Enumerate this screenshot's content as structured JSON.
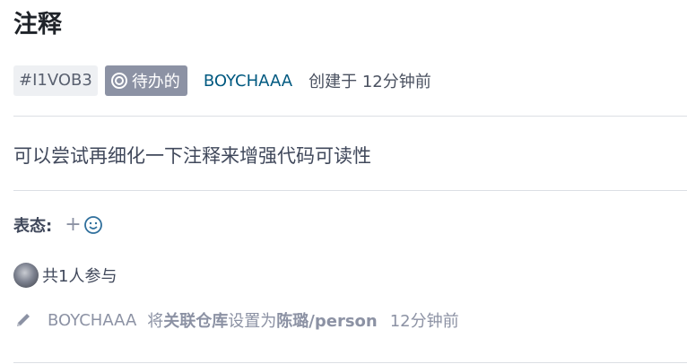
{
  "issue": {
    "title": "注释",
    "id": "#I1VOB3",
    "status": "待办的",
    "status_icon": "target-circle-icon",
    "author": "BOYCHAAA",
    "created": "创建于 12分钟前",
    "body": "可以尝试再细化一下注释来增强代码可读性"
  },
  "reactions": {
    "label": "表态:",
    "add_symbol": "+",
    "emoji_icon": "smiley-icon"
  },
  "participants": {
    "text": "共1人参与"
  },
  "activity": {
    "icon": "pencil-icon",
    "user": "BOYCHAAA",
    "verb": "将",
    "target": "关联仓库",
    "action": "设置为",
    "value": "陈璐/person",
    "time": "12分钟前"
  },
  "colors": {
    "status_bg": "#8c92a4",
    "link": "#005980",
    "id_bg": "#eef0f3"
  }
}
